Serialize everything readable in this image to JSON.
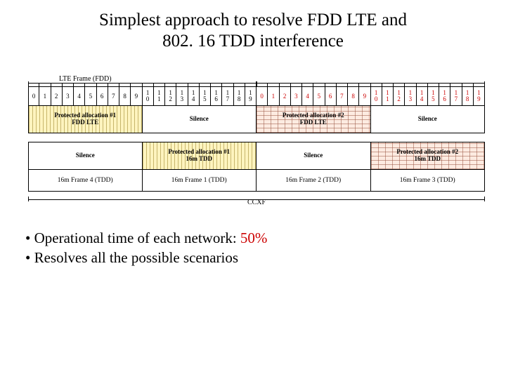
{
  "title_line1": "Simplest approach to resolve FDD LTE and",
  "title_line2": "802. 16 TDD interference",
  "lte_frame_label": "LTE Frame (FDD)",
  "subframes": {
    "cells": [
      {
        "t": "0"
      },
      {
        "t": "1"
      },
      {
        "t": "2"
      },
      {
        "t": "3"
      },
      {
        "t": "4"
      },
      {
        "t": "5"
      },
      {
        "t": "6"
      },
      {
        "t": "7"
      },
      {
        "t": "8"
      },
      {
        "t": "9"
      },
      {
        "u": "1",
        "t": "0"
      },
      {
        "u": "1",
        "t": "1"
      },
      {
        "u": "1",
        "t": "2"
      },
      {
        "u": "1",
        "t": "3"
      },
      {
        "u": "1",
        "t": "4"
      },
      {
        "u": "1",
        "t": "5"
      },
      {
        "u": "1",
        "t": "6"
      },
      {
        "u": "1",
        "t": "7"
      },
      {
        "u": "1",
        "t": "8"
      },
      {
        "u": "1",
        "t": "9"
      },
      {
        "t": "0",
        "r": true
      },
      {
        "t": "1",
        "r": true
      },
      {
        "t": "2",
        "r": true
      },
      {
        "t": "3",
        "r": true
      },
      {
        "t": "4",
        "r": true
      },
      {
        "t": "5",
        "r": true
      },
      {
        "t": "6",
        "r": true
      },
      {
        "t": "7",
        "r": true
      },
      {
        "t": "8",
        "r": true
      },
      {
        "t": "9",
        "r": true
      },
      {
        "u": "1",
        "t": "0",
        "r": true
      },
      {
        "u": "1",
        "t": "1",
        "r": true
      },
      {
        "u": "1",
        "t": "2",
        "r": true
      },
      {
        "u": "1",
        "t": "3",
        "r": true
      },
      {
        "u": "1",
        "t": "4",
        "r": true
      },
      {
        "u": "1",
        "t": "5",
        "r": true
      },
      {
        "u": "1",
        "t": "6",
        "r": true
      },
      {
        "u": "1",
        "t": "7",
        "r": true
      },
      {
        "u": "1",
        "t": "8",
        "r": true
      },
      {
        "u": "1",
        "t": "9",
        "r": true
      }
    ]
  },
  "row_fdd": [
    {
      "text": "Protected allocation #1\nFDD LTE",
      "class": "hatch-yellow"
    },
    {
      "text": "Silence",
      "class": ""
    },
    {
      "text": "Protected allocation #2\nFDD LTE",
      "class": "hatch-brick"
    },
    {
      "text": "Silence",
      "class": ""
    }
  ],
  "row_tdd": [
    {
      "text": "Silence",
      "class": ""
    },
    {
      "text": "Protected allocation #1\n16m TDD",
      "class": "hatch-yellow"
    },
    {
      "text": "Silence",
      "class": ""
    },
    {
      "text": "Protected allocation #2\n16m TDD",
      "class": "hatch-brick"
    }
  ],
  "row_frames": [
    "16m Frame 4 (TDD)",
    "16m Frame 1 (TDD)",
    "16m Frame 2 (TDD)",
    "16m Frame 3 (TDD)"
  ],
  "ccxf": "CCXF",
  "bullet1_a": "Operational time of each network: ",
  "bullet1_b": "50%",
  "bullet2": "Resolves all the possible scenarios"
}
